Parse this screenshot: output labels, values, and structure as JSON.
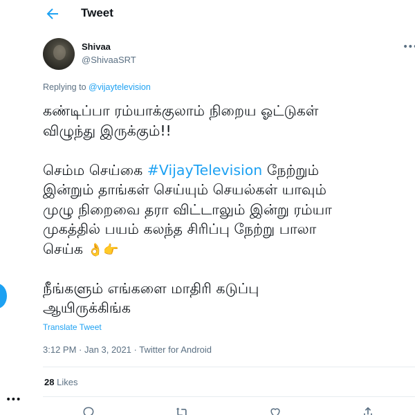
{
  "header": {
    "title": "Tweet",
    "back_icon": "arrow-left-icon",
    "accent": "#1da1f2"
  },
  "author": {
    "name": "Shivaa",
    "handle": "@ShivaaSRT"
  },
  "reply": {
    "prefix": "Replying to",
    "mention": "@vijaytelevision"
  },
  "tweet": {
    "line1": "கண்டிப்பா ரம்யாக்குலாம் நிறைய ஓட்டுகள்",
    "line2": "விழுந்து இருக்கும்!!",
    "line3_a": "செம்ம செய்கை",
    "hashtag": "#VijayTelevision",
    "line3_b": " நேற்றும்",
    "line4": "இன்றும் தாங்கள் செய்யும் செயல்கள் யாவும்",
    "line5": "முழு நிறைவை தரா விட்டாலும் இன்று ரம்யா",
    "line6": "முகத்தில் பயம் கலந்த சிரிப்பு நேற்று பாலா",
    "line7": "செய்க",
    "emoji1": "👌",
    "emoji2": "👉",
    "line8": "நீங்களும் எங்களை மாதிரி கடுப்பு",
    "line9": "ஆயிருக்கிங்க"
  },
  "translate_label": "Translate Tweet",
  "meta": "3:12 PM · Jan 3, 2021 · Twitter for Android",
  "stats": {
    "likes_count": "28",
    "likes_label": "Likes"
  },
  "icons": [
    "reply-icon",
    "retweet-icon",
    "like-icon",
    "share-icon",
    "more-icon"
  ]
}
